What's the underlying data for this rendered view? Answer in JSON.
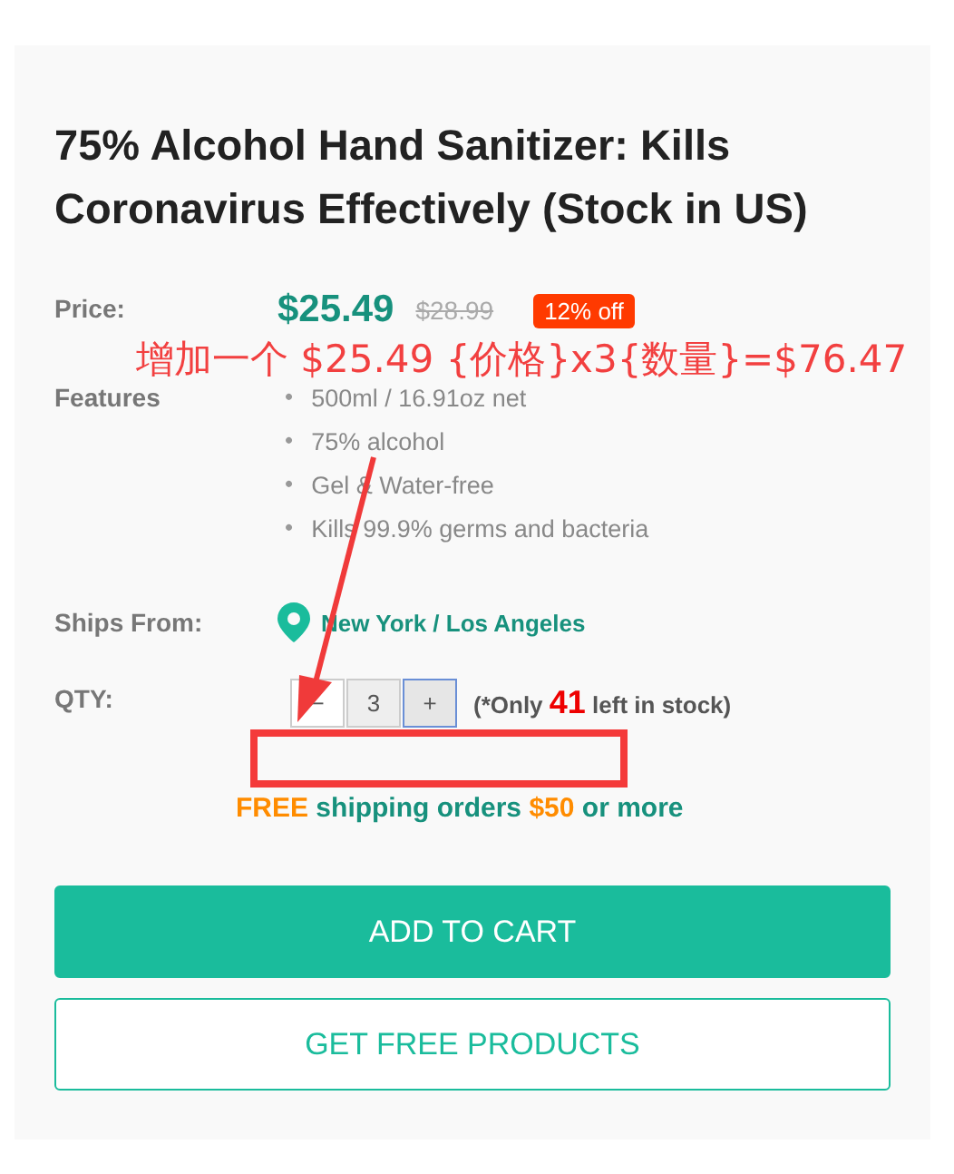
{
  "product": {
    "title": "75% Alcohol Hand Sanitizer: Kills Coronavirus Effectively (Stock in US)",
    "price_label": "Price:",
    "price": "$25.49",
    "old_price": "$28.99",
    "discount": "12% off",
    "features_label": "Features",
    "features": [
      {
        "marker": "•",
        "text": "500ml / 16.91oz net"
      },
      {
        "marker": "•",
        "text": "75% alcohol"
      },
      {
        "marker": "•",
        "text": "Gel & Water-free"
      },
      {
        "marker": "•",
        "text": "Kills 99.9% germs and bacteria"
      }
    ],
    "ships_label": "Ships From:",
    "ships_from": "New York / Los Angeles",
    "qty_label": "QTY:",
    "qty_minus": "−",
    "qty_value": "3",
    "qty_plus": "+",
    "stock_note": [
      {
        "text": "(*Only ",
        "kind": "plain"
      },
      {
        "text": "41",
        "kind": "count"
      },
      {
        "text": " left in stock)",
        "kind": "plain"
      }
    ],
    "shipping_note": [
      {
        "text": "FREE",
        "kind": "accent"
      },
      {
        "text": " shipping orders ",
        "kind": "plain"
      },
      {
        "text": "$50",
        "kind": "accent"
      },
      {
        "text": " or more",
        "kind": "plain"
      }
    ],
    "buttons": [
      {
        "label": "ADD TO CART",
        "kind": "primary"
      },
      {
        "label": "GET FREE PRODUCTS",
        "kind": "outline"
      }
    ]
  },
  "annotation": {
    "text": "增加一个 $25.49 {价格}x3{数量}=$76.47"
  }
}
